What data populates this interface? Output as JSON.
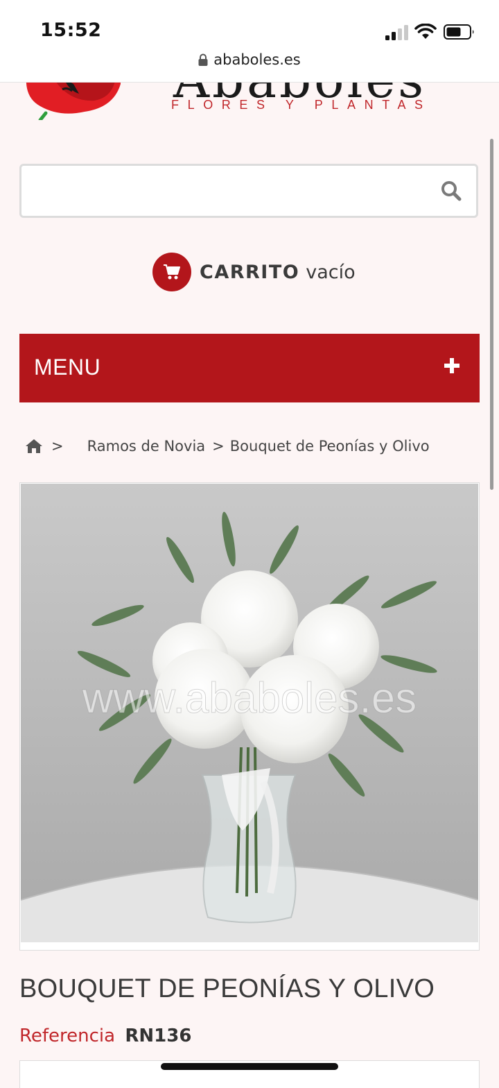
{
  "status_bar": {
    "time": "15:52",
    "url": "ababoles.es"
  },
  "logo": {
    "brand": "Ababoles",
    "tagline": "FLORES Y PLANTAS"
  },
  "search": {
    "value": "",
    "placeholder": ""
  },
  "cart": {
    "label": "CARRITO",
    "status": "vacío"
  },
  "menu": {
    "label": "MENU",
    "toggle": "+"
  },
  "breadcrumb": {
    "separator": ">",
    "items": [
      "Ramos de Novia",
      "Bouquet de Peonías y Olivo"
    ]
  },
  "product": {
    "image_watermark": "www.ababoles.es",
    "title": "BOUQUET DE PEONÍAS Y OLIVO",
    "reference_label": "Referencia",
    "reference_value": "RN136"
  },
  "colors": {
    "accent": "#b3161b",
    "background": "#fdf5f5"
  }
}
